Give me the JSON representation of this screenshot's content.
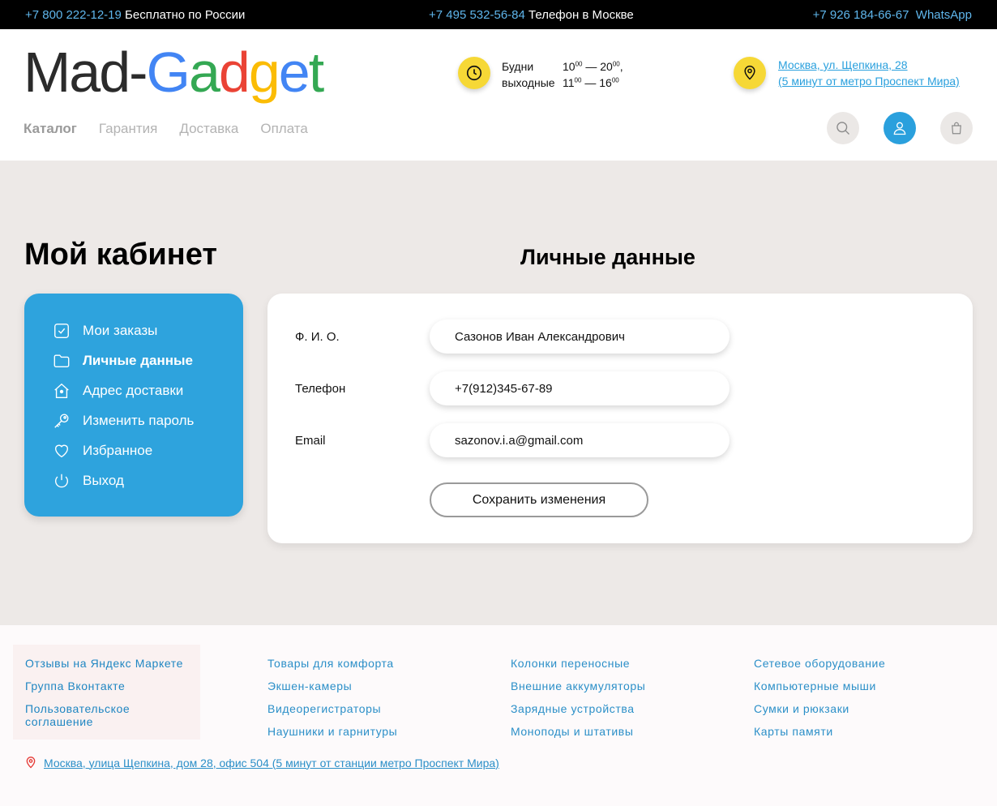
{
  "topbar": {
    "phone1": "+7 800 222-12-19",
    "phone1_label": "Бесплатно по России",
    "phone2": "+7 495 532-56-84",
    "phone2_label": "Телефон в Москве",
    "phone3": "+7 926 184-66-67",
    "phone3_label": "WhatsApp"
  },
  "logo": {
    "part1": "Mad-",
    "letters": [
      "G",
      "a",
      "d",
      "g",
      "e",
      "t"
    ],
    "colors": [
      "#4285f4",
      "#34a853",
      "#ea4335",
      "#fbbc05",
      "#4285f4",
      "#34a853"
    ]
  },
  "hours": {
    "weekdays_label": "Будни",
    "weekend_label": "выходные",
    "weekdays_from": "10",
    "weekdays_to": "20",
    "weekend_from": "11",
    "weekend_to": "16",
    "sup": "00",
    "dash": " — ",
    "comma": ","
  },
  "address": {
    "line1": "Москва, ул. Щепкина, 28",
    "line2": "(5 минут от метро Проспект Мира)"
  },
  "nav": {
    "items": [
      "Каталог",
      "Гарантия",
      "Доставка",
      "Оплата"
    ]
  },
  "page": {
    "title": "Мой кабинет",
    "section_title": "Личные данные"
  },
  "sidebar": {
    "items": [
      {
        "label": "Мои заказы",
        "icon": "orders-icon"
      },
      {
        "label": "Личные данные",
        "icon": "folder-icon"
      },
      {
        "label": "Адрес доставки",
        "icon": "home-icon"
      },
      {
        "label": "Изменить пароль",
        "icon": "key-icon"
      },
      {
        "label": "Избранное",
        "icon": "heart-icon"
      },
      {
        "label": "Выход",
        "icon": "power-icon"
      }
    ],
    "active_index": 1
  },
  "form": {
    "name_label": "Ф. И. О.",
    "name_value": "Сазонов Иван Александрович",
    "phone_label": "Телефон",
    "phone_value": "+7(912)345-67-89",
    "email_label": "Email",
    "email_value": "sazonov.i.a@gmail.com",
    "save_label": "Сохранить изменения"
  },
  "footer": {
    "col1": [
      "Отзывы на Яндекс Маркете",
      "Группа Вконтакте",
      "Пользовательское соглашение"
    ],
    "col2": [
      "Товары для комфорта",
      "Экшен-камеры",
      "Видеорегистраторы",
      "Наушники и гарнитуры"
    ],
    "col3": [
      "Колонки переносные",
      "Внешние аккумуляторы",
      "Зарядные устройства",
      "Моноподы и штативы"
    ],
    "col4": [
      "Сетевое оборудование",
      "Компьютерные мыши",
      "Сумки и рюкзаки",
      "Карты памяти"
    ],
    "address": "Москва, улица Щепкина, дом 28, офис 504 (5 минут от станции метро Проспект Мира)"
  },
  "colors": {
    "accent": "#2ea3dd",
    "yellow": "#f6d836",
    "topbar_link": "#5fb6ec"
  }
}
